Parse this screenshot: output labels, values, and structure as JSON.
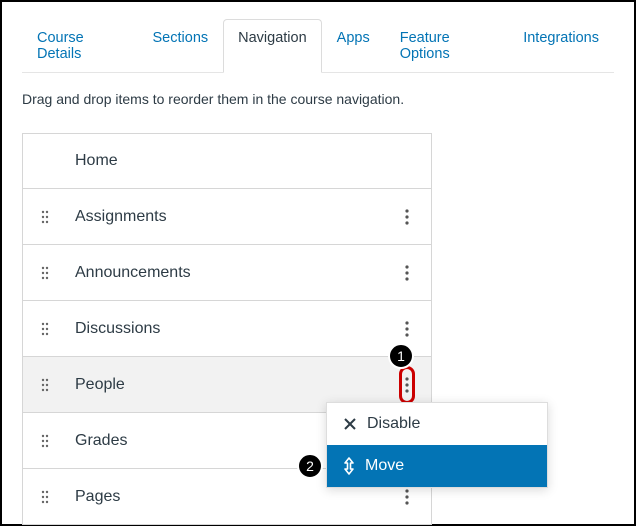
{
  "tabs": [
    {
      "label": "Course Details"
    },
    {
      "label": "Sections"
    },
    {
      "label": "Navigation",
      "active": true
    },
    {
      "label": "Apps"
    },
    {
      "label": "Feature Options"
    },
    {
      "label": "Integrations"
    }
  ],
  "helper_text": "Drag and drop items to reorder them in the course navigation.",
  "nav_items": [
    {
      "label": "Home"
    },
    {
      "label": "Assignments"
    },
    {
      "label": "Announcements"
    },
    {
      "label": "Discussions"
    },
    {
      "label": "People"
    },
    {
      "label": "Grades"
    },
    {
      "label": "Pages"
    }
  ],
  "menu": {
    "disable": "Disable",
    "move": "Move"
  },
  "callouts": {
    "one": "1",
    "two": "2"
  }
}
